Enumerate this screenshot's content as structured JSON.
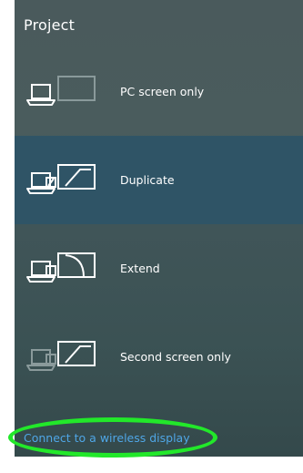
{
  "panel": {
    "title": "Project"
  },
  "options": [
    {
      "label": "PC screen only",
      "selected": false,
      "icon": "pc-screen-only-icon"
    },
    {
      "label": "Duplicate",
      "selected": true,
      "icon": "duplicate-icon"
    },
    {
      "label": "Extend",
      "selected": false,
      "icon": "extend-icon"
    },
    {
      "label": "Second screen only",
      "selected": false,
      "icon": "second-screen-only-icon"
    }
  ],
  "footer": {
    "connect_link": "Connect to a wireless display"
  },
  "colors": {
    "panel_background": "#445a5c",
    "selected_row": "#2f5466",
    "link": "#4fa6e6",
    "highlight_ring": "#22e82a",
    "icon_active": "#ffffff",
    "icon_inactive": "#8a9a9b"
  }
}
